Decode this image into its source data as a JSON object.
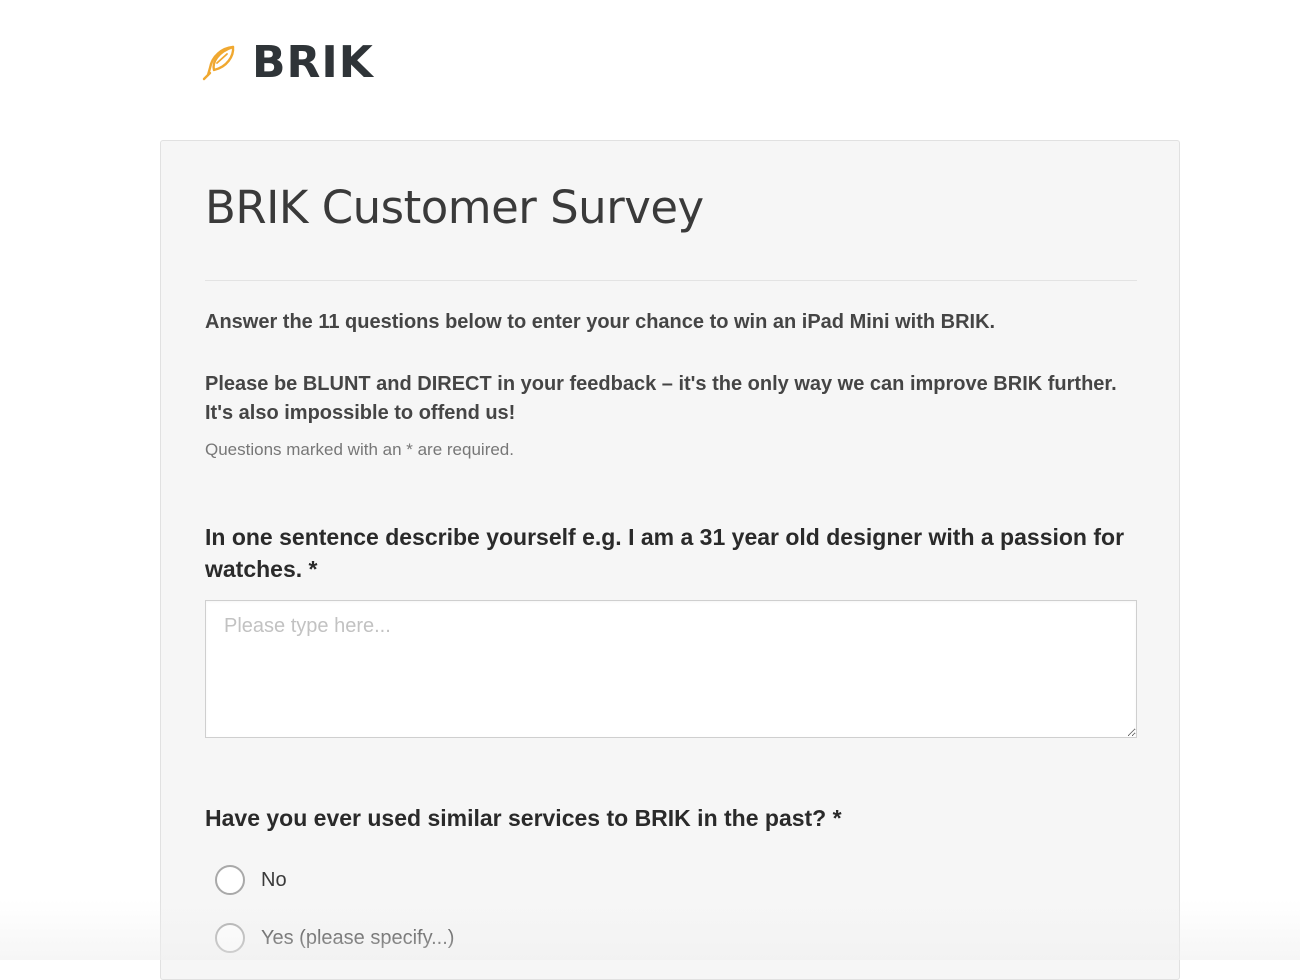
{
  "brand": {
    "name": "BRIK",
    "icon": "feather-icon",
    "icon_color": "#f0a830"
  },
  "survey": {
    "title": "BRIK Customer Survey",
    "intro": "Answer the 11 questions below to enter your chance to win an iPad Mini with BRIK.",
    "intro2": "Please be BLUNT and DIRECT in your feedback – it's the only way we can improve BRIK further. It's also impossible to offend us!",
    "required_note": "Questions marked with an * are required."
  },
  "questions": [
    {
      "label": "In one sentence describe yourself e.g. I am a 31 year old designer with a passion for watches. *",
      "placeholder": "Please type here..."
    },
    {
      "label": "Have you ever used similar services to BRIK in the past? *",
      "options": [
        "No",
        "Yes (please specify...)"
      ]
    }
  ]
}
